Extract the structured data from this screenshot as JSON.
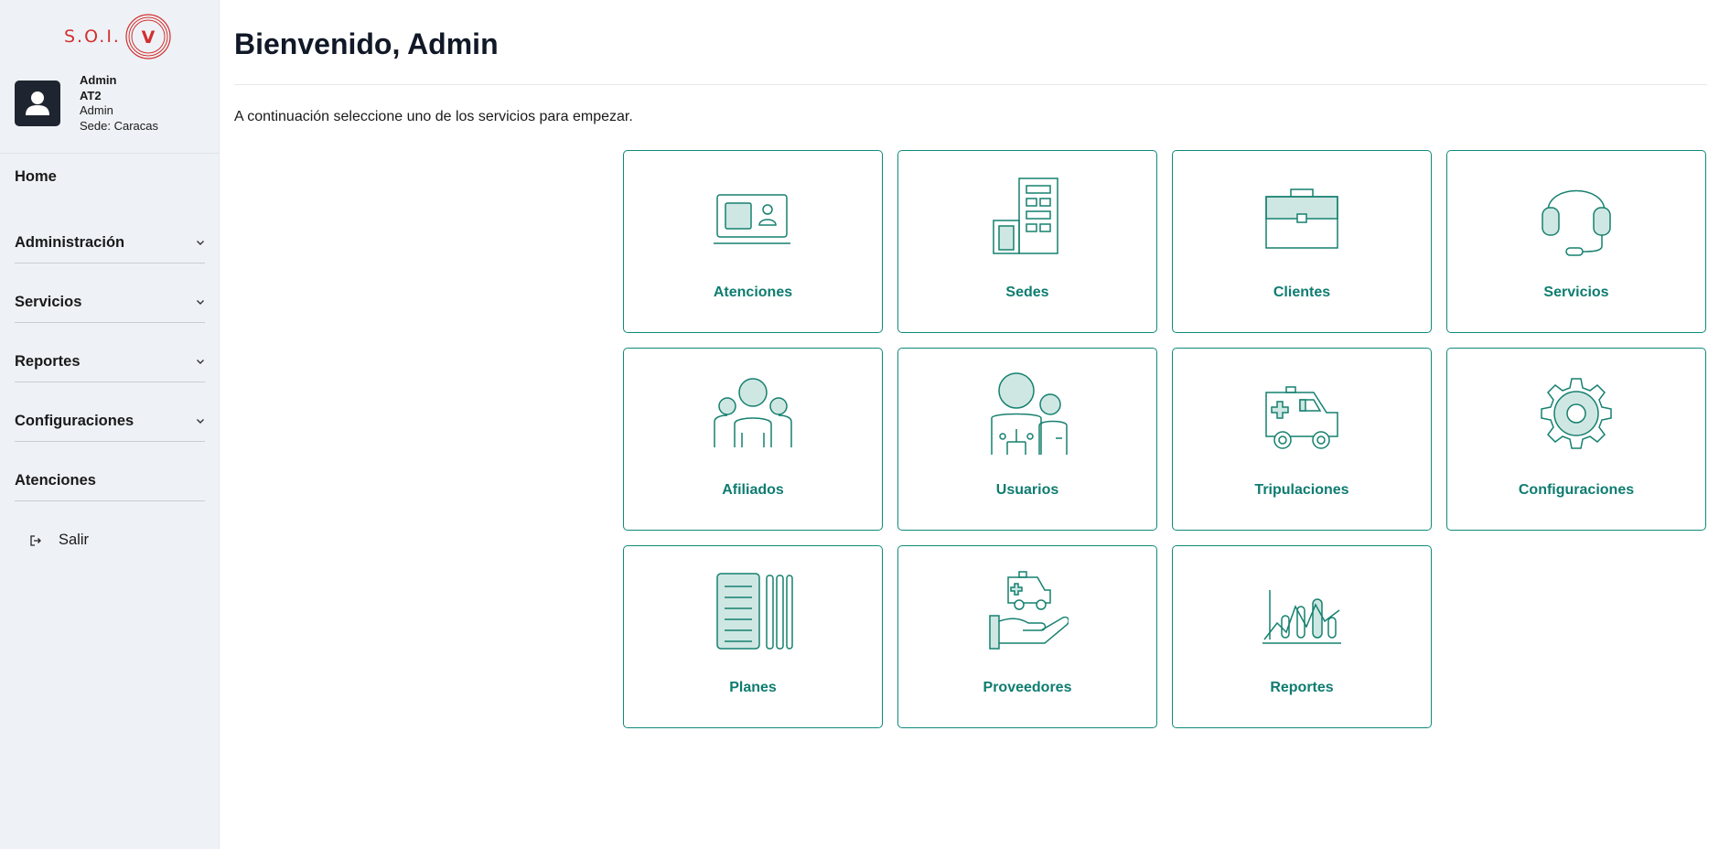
{
  "brand": {
    "logo_text": "S.O.I.",
    "logo_mark": "V",
    "color": "#d32f2f"
  },
  "user": {
    "name": "Admin",
    "code": "AT2",
    "role": "Admin",
    "sede": "Sede: Caracas"
  },
  "sidebar": {
    "items": [
      {
        "label": "Home",
        "icon": null
      },
      {
        "label": "Administración",
        "icon": "chevron-down-icon"
      },
      {
        "label": "Servicios",
        "icon": "chevron-down-icon"
      },
      {
        "label": "Reportes",
        "icon": "chevron-down-icon"
      },
      {
        "label": "Configuraciones",
        "icon": "chevron-down-icon"
      },
      {
        "label": "Atenciones",
        "icon": null
      }
    ],
    "logout_label": "Salir"
  },
  "main": {
    "title": "Bienvenido, Admin",
    "subtitle": "A continuación seleccione uno de los servicios para empezar.",
    "accent": "#0e7c70",
    "cards": [
      {
        "label": "Atenciones",
        "icon": "id-card-icon"
      },
      {
        "label": "Sedes",
        "icon": "building-icon"
      },
      {
        "label": "Clientes",
        "icon": "briefcase-icon"
      },
      {
        "label": "Servicios",
        "icon": "headset-icon"
      },
      {
        "label": "Afiliados",
        "icon": "group-icon"
      },
      {
        "label": "Usuarios",
        "icon": "users-network-icon"
      },
      {
        "label": "Tripulaciones",
        "icon": "ambulance-icon"
      },
      {
        "label": "Configuraciones",
        "icon": "gear-icon"
      },
      {
        "label": "Planes",
        "icon": "documents-icon"
      },
      {
        "label": "Proveedores",
        "icon": "hand-ambulance-icon"
      },
      {
        "label": "Reportes",
        "icon": "chart-icon"
      }
    ]
  }
}
